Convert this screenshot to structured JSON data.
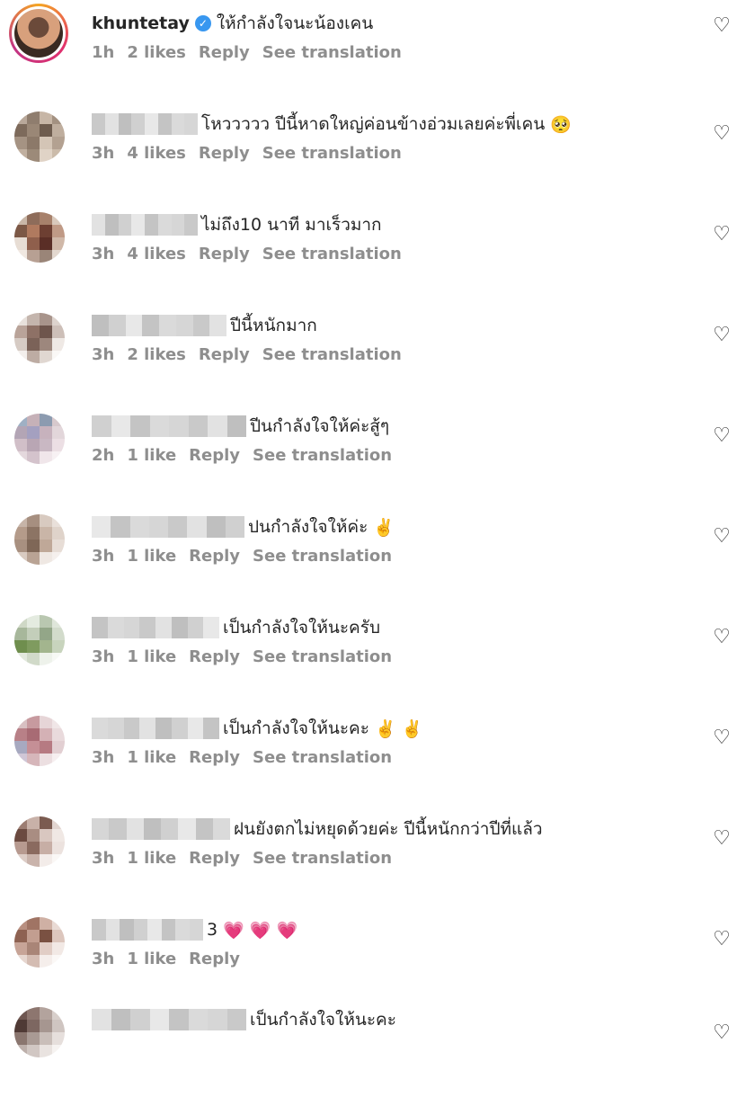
{
  "comments": [
    {
      "username": "khuntetay",
      "verified": true,
      "text": "ให้กำลังใจนะน้องเคน",
      "emoji": "",
      "time": "1h",
      "likes": "2 likes",
      "reply": "Reply",
      "translate": "See translation"
    },
    {
      "username": "",
      "text": "โหววววว ปีนี้หาดใหญ่ค่อนข้างอ่วมเลยค่ะพี่เคน",
      "emoji": "🥺",
      "time": "3h",
      "likes": "4 likes",
      "reply": "Reply",
      "translate": "See translation"
    },
    {
      "username": "",
      "text": "ไม่ถึง10 นาที มาเร็วมาก",
      "emoji": "",
      "time": "3h",
      "likes": "4 likes",
      "reply": "Reply",
      "translate": "See translation"
    },
    {
      "username": "",
      "text": "ปีนี้หนักมาก",
      "emoji": "",
      "time": "3h",
      "likes": "2 likes",
      "reply": "Reply",
      "translate": "See translation"
    },
    {
      "username": "",
      "text": "ปีนกำลังใจให้ค่ะสู้ๆ",
      "emoji": "",
      "time": "2h",
      "likes": "1 like",
      "reply": "Reply",
      "translate": "See translation"
    },
    {
      "username": "",
      "text": "ปนกำลังใจให้ค่ะ",
      "emoji": "✌️",
      "time": "3h",
      "likes": "1 like",
      "reply": "Reply",
      "translate": "See translation"
    },
    {
      "username": "",
      "text": "เป็นกำลังใจให้นะครับ",
      "emoji": "",
      "time": "3h",
      "likes": "1 like",
      "reply": "Reply",
      "translate": "See translation"
    },
    {
      "username": "",
      "text": "เป็นกำลังใจให้นะคะ",
      "emoji": "✌️ ✌️",
      "time": "3h",
      "likes": "1 like",
      "reply": "Reply",
      "translate": "See translation"
    },
    {
      "username": "",
      "text": "ฝนยังตกไม่หยุดด้วยค่ะ ปีนี้หนักกว่าปีที่แล้ว",
      "emoji": "",
      "time": "3h",
      "likes": "1 like",
      "reply": "Reply",
      "translate": "See translation"
    },
    {
      "username": "",
      "text": "3",
      "emoji": "💗 💗 💗",
      "time": "3h",
      "likes": "1 like",
      "reply": "Reply",
      "translate": ""
    },
    {
      "username": "",
      "text": "เป็นกำลังใจให้นะคะ",
      "emoji": "",
      "time": "",
      "likes": "",
      "reply": "",
      "translate": ""
    }
  ],
  "icons": {
    "like": "heart-outline-icon",
    "verified": "verified-badge-icon"
  },
  "colors": {
    "text": "#262626",
    "meta": "#8e8e8e",
    "verified": "#3897f0"
  }
}
